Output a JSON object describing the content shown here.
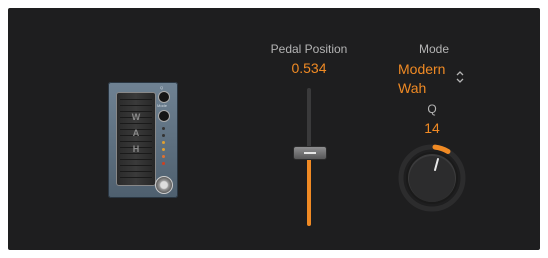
{
  "pedal": {
    "word": [
      "W",
      "A",
      "H"
    ],
    "side_labels": [
      "Q",
      "Mode"
    ]
  },
  "pedal_position": {
    "label": "Pedal Position",
    "value_text": "0.534",
    "value": 0.534
  },
  "mode": {
    "label": "Mode",
    "value_line1": "Modern",
    "value_line2": "Wah"
  },
  "q": {
    "label": "Q",
    "value_text": "14"
  },
  "colors": {
    "accent": "#f08a24",
    "panel": "#1e1e1f",
    "label": "#b4b4b4"
  },
  "icons": [
    "chevron-updown-icon",
    "slider-grip-icon"
  ]
}
